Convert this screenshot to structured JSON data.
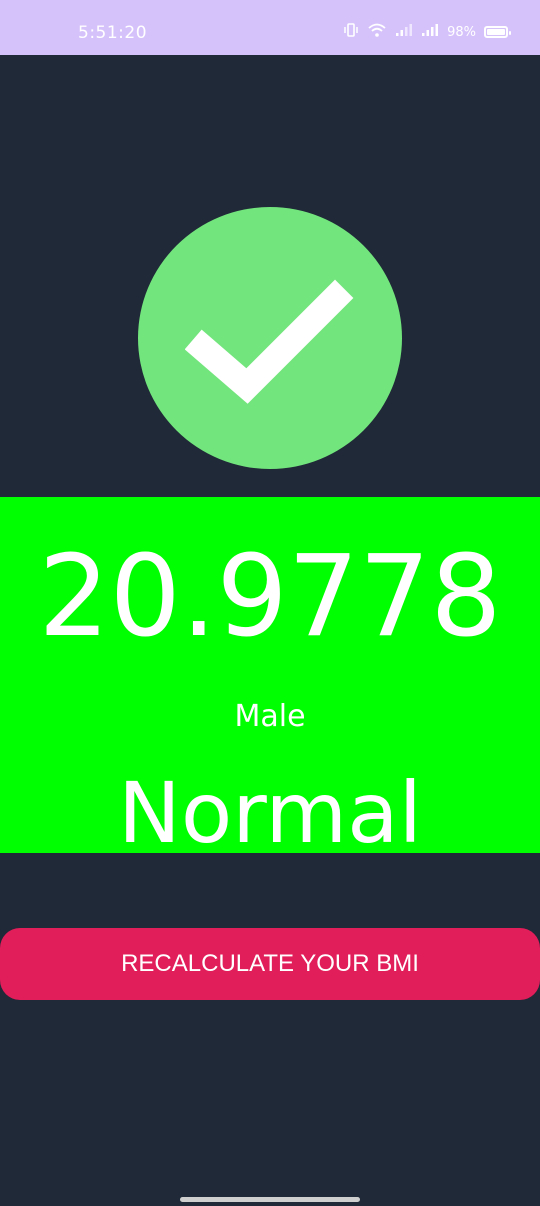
{
  "status_bar": {
    "time": "5:51:20",
    "battery_percent": "98%",
    "icons": [
      "vibrate-icon",
      "wifi-icon",
      "signal-icon",
      "signal-icon",
      "battery-icon"
    ]
  },
  "result": {
    "icon": "check-circle-icon",
    "bmi_value": "20.9778",
    "gender": "Male",
    "category": "Normal"
  },
  "actions": {
    "recalculate_label": "RECALCULATE YOUR BMI"
  },
  "colors": {
    "background": "#1f2937",
    "status_bar": "#d6c2fb",
    "result_panel": "#00ff00",
    "check_circle": "#73e57d",
    "button": "#e11d5a"
  }
}
